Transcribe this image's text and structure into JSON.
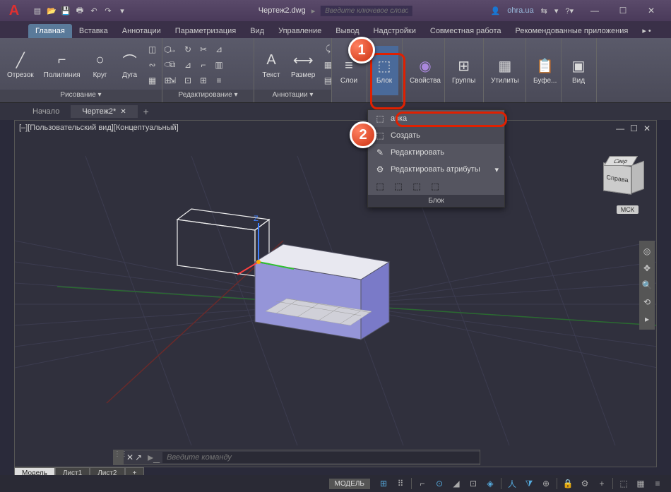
{
  "title": {
    "filename": "Чертеж2.dwg",
    "search_placeholder": "Введите ключевое слово/фразу",
    "user": "ohra.ua"
  },
  "win": {
    "min": "—",
    "max": "☐",
    "close": "✕"
  },
  "qat": [
    "▤",
    "📂",
    "💾",
    "🖶",
    "↶",
    "↷",
    "▾"
  ],
  "ribbon_tabs": [
    "Главная",
    "Вставка",
    "Аннотации",
    "Параметризация",
    "Вид",
    "Управление",
    "Вывод",
    "Надстройки",
    "Совместная работа",
    "Рекомендованные приложения"
  ],
  "panels": {
    "draw": {
      "title": "Рисование ▾",
      "items": [
        "Отрезок",
        "Полилиния",
        "Круг",
        "Дуга"
      ]
    },
    "modify": {
      "title": "Редактирование ▾"
    },
    "anno": {
      "title": "Аннотации ▾",
      "items": [
        "Текст",
        "Размер"
      ]
    },
    "layers": {
      "title": "Слои"
    },
    "block": {
      "title": "Блок"
    },
    "props": {
      "title": "Свойства"
    },
    "groups": {
      "title": "Группы"
    },
    "utils": {
      "title": "Утилиты"
    },
    "clip": {
      "title": "Буфе..."
    },
    "view": {
      "title": "Вид"
    }
  },
  "dropdown": {
    "ins": "авка",
    "create": "Создать",
    "edit": "Редактировать",
    "attrs": "Редактировать атрибуты",
    "footer": "Блок"
  },
  "filetabs": {
    "start": "Начало",
    "drawing": "Чертеж2*"
  },
  "viewport": {
    "label": "[–][Пользовательский вид][Концептуальный]"
  },
  "viewcube": {
    "front": "Справа",
    "top": "Свер"
  },
  "coord": "МСК",
  "cmd": {
    "placeholder": "Введите команду"
  },
  "modeltabs": [
    "Модель",
    "Лист1",
    "Лист2",
    "+"
  ],
  "statusbar": {
    "model": "МОДЕЛЬ"
  },
  "anno": {
    "one": "1",
    "two": "2"
  }
}
